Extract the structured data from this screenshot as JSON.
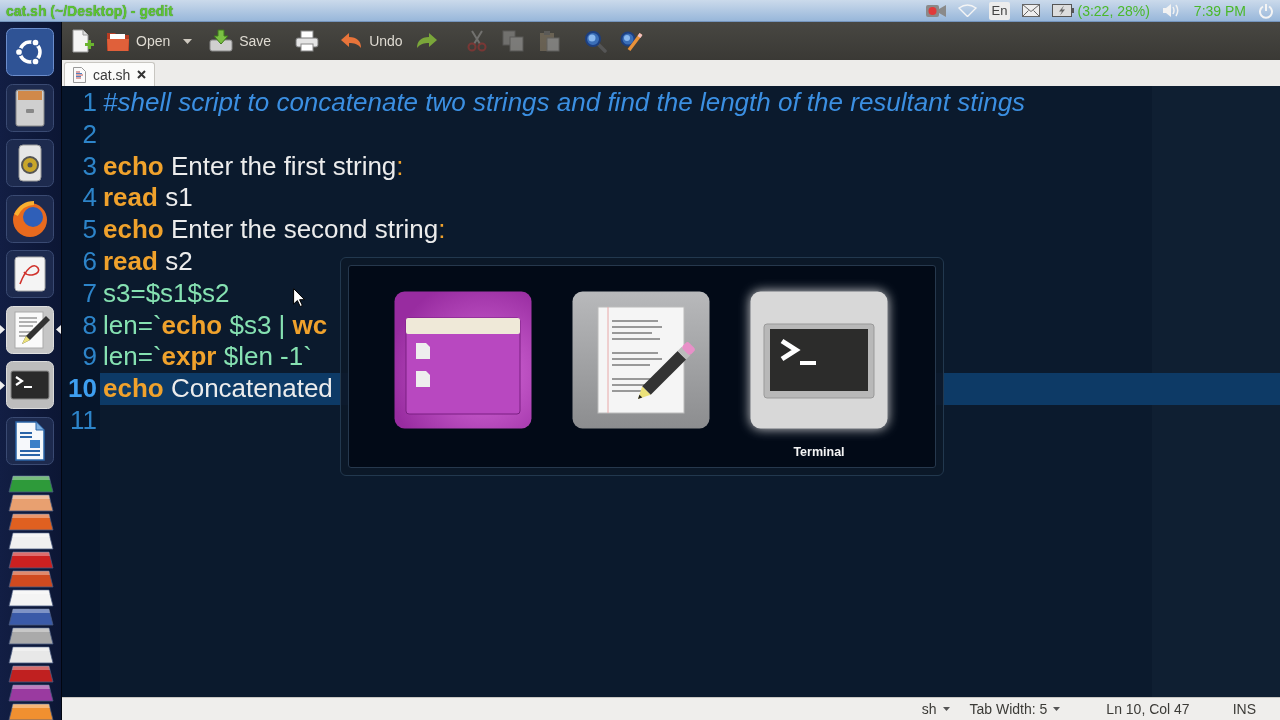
{
  "top_panel": {
    "window_title": "cat.sh (~/Desktop) - gedit",
    "keyboard_layout": "En",
    "battery": "(3:22, 28%)",
    "clock": "7:39 PM"
  },
  "launcher": {
    "items": [
      {
        "kind": "home",
        "running": false,
        "focused": false
      },
      {
        "kind": "files",
        "running": false,
        "focused": false
      },
      {
        "kind": "music",
        "running": false,
        "focused": false
      },
      {
        "kind": "browser",
        "running": false,
        "focused": false
      },
      {
        "kind": "viewer",
        "running": false,
        "focused": false
      },
      {
        "kind": "editor",
        "running": true,
        "focused": true
      },
      {
        "kind": "terminal",
        "running": true,
        "focused": false
      },
      {
        "kind": "writer",
        "running": false,
        "focused": false
      }
    ]
  },
  "toolbar": {
    "items": [
      {
        "kind": "new",
        "disabled": false
      },
      {
        "kind": "open",
        "label": "Open",
        "disabled": false
      },
      {
        "kind": "open-menu",
        "disabled": false
      },
      {
        "kind": "save",
        "label": "Save",
        "disabled": false
      },
      {
        "kind": "print",
        "disabled": false
      },
      {
        "kind": "undo",
        "label": "Undo",
        "disabled": false
      },
      {
        "kind": "redo",
        "disabled": false
      },
      {
        "kind": "cut",
        "disabled": true
      },
      {
        "kind": "copy",
        "disabled": true
      },
      {
        "kind": "paste",
        "disabled": true
      },
      {
        "kind": "find",
        "disabled": false
      },
      {
        "kind": "replace",
        "disabled": false
      }
    ]
  },
  "tabs": [
    {
      "label": "cat.sh",
      "selected": true
    }
  ],
  "editor": {
    "lines": [
      {
        "number": "1",
        "current": false,
        "tokens": [
          {
            "text": "#shell script to concatenate two strings and find the length of the resultant stings",
            "kind": "comment"
          }
        ]
      },
      {
        "number": "2",
        "current": false
      },
      {
        "number": "3",
        "current": false,
        "tokens": [
          {
            "text": "echo",
            "kind": "keyword"
          },
          {
            "text": " Enter the first string",
            "kind": "plain"
          },
          {
            "text": ":",
            "kind": "operator"
          }
        ]
      },
      {
        "number": "4",
        "current": false,
        "tokens": [
          {
            "text": "read",
            "kind": "keyword"
          },
          {
            "text": " s1",
            "kind": "plain"
          }
        ]
      },
      {
        "number": "5",
        "current": false,
        "tokens": [
          {
            "text": "echo",
            "kind": "keyword"
          },
          {
            "text": " Enter the second string",
            "kind": "plain"
          },
          {
            "text": ":",
            "kind": "operator"
          }
        ]
      },
      {
        "number": "6",
        "current": false,
        "tokens": [
          {
            "text": "read",
            "kind": "keyword"
          },
          {
            "text": " s2",
            "kind": "plain"
          }
        ]
      },
      {
        "number": "7",
        "current": false,
        "tokens": [
          {
            "text": "s3=$s1$s2",
            "kind": "variable"
          }
        ]
      },
      {
        "number": "8",
        "current": false,
        "tokens": [
          {
            "text": "len=`",
            "kind": "variable"
          },
          {
            "text": "echo",
            "kind": "keyword"
          },
          {
            "text": " $s3 | ",
            "kind": "variable"
          },
          {
            "text": "wc",
            "kind": "keyword"
          }
        ]
      },
      {
        "number": "9",
        "current": false,
        "tokens": [
          {
            "text": "len=`",
            "kind": "variable"
          },
          {
            "text": "expr",
            "kind": "keyword"
          },
          {
            "text": " $len -1`",
            "kind": "variable"
          }
        ]
      },
      {
        "number": "10",
        "current": true,
        "tokens": [
          {
            "text": "echo",
            "kind": "keyword"
          },
          {
            "text": " Concatenated",
            "kind": "plain"
          }
        ]
      },
      {
        "number": "11",
        "current": false
      }
    ]
  },
  "app_switcher": {
    "items": [
      {
        "kind": "window",
        "selected": false
      },
      {
        "kind": "editor",
        "selected": false
      },
      {
        "kind": "terminal",
        "selected": true,
        "label": "Terminal"
      }
    ]
  },
  "status_bar": {
    "language": "sh",
    "tab_width": "Tab Width: 5",
    "cursor_position": "Ln 10, Col 47",
    "insert_mode": "INS"
  }
}
